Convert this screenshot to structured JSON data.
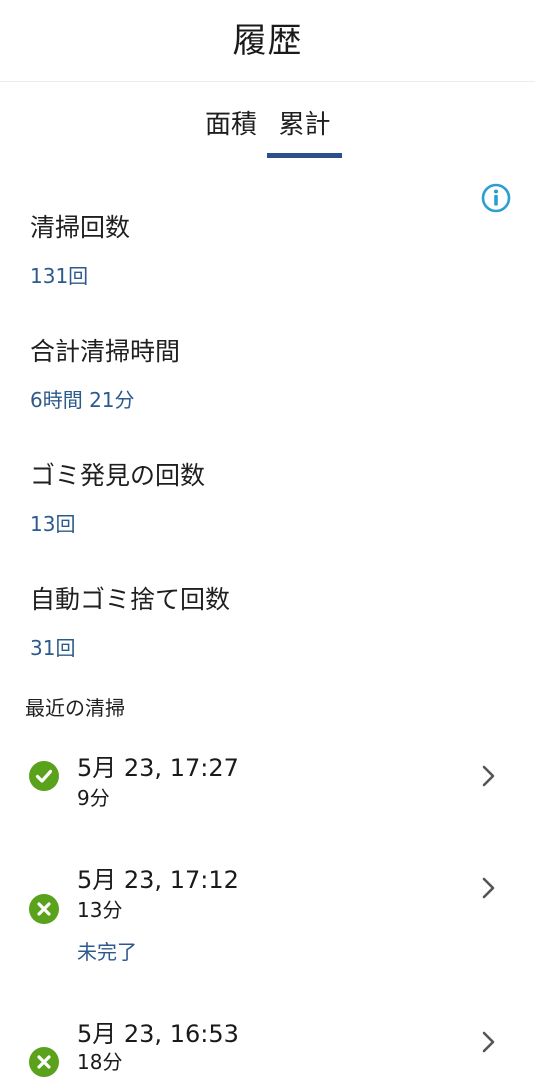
{
  "header": {
    "title": "履歴"
  },
  "tabs": [
    {
      "label": "面積",
      "active": false
    },
    {
      "label": "累計",
      "active": true
    }
  ],
  "info": {
    "icon": "info-icon"
  },
  "stats": [
    {
      "label": "清掃回数",
      "value": "131回"
    },
    {
      "label": "合計清掃時間",
      "value": "6時間 21分"
    },
    {
      "label": "ゴミ発見の回数",
      "value": "13回"
    },
    {
      "label": "自動ゴミ捨て回数",
      "value": "31回"
    }
  ],
  "recent": {
    "title": "最近の清掃",
    "items": [
      {
        "date": "5月 23, 17:27",
        "duration": "9分",
        "status": "completed",
        "status_icon": "check-circle-icon",
        "note": ""
      },
      {
        "date": "5月 23, 17:12",
        "duration": "13分",
        "status": "incomplete",
        "status_icon": "x-circle-icon",
        "note": "未完了"
      },
      {
        "date": "5月 23, 16:53",
        "duration": "18分",
        "status": "incomplete",
        "status_icon": "x-circle-icon",
        "note": ""
      }
    ]
  },
  "colors": {
    "accent": "#2b4f8f",
    "value_text": "#2d5a8c",
    "info_icon": "#2a9fd0",
    "status_green": "#5aa11c"
  }
}
